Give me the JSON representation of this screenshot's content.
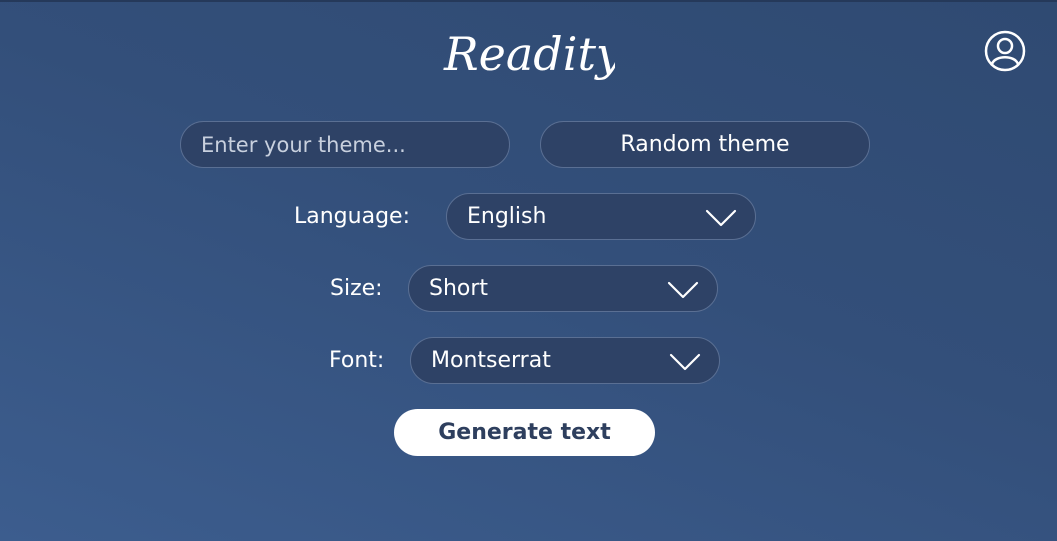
{
  "header": {
    "logo_text": "Readity",
    "user_icon": "user-circle-icon"
  },
  "controls": {
    "theme_placeholder": "Enter your theme...",
    "random_theme_label": "Random theme",
    "language": {
      "label": "Language:",
      "value": "English"
    },
    "size": {
      "label": "Size:",
      "value": "Short"
    },
    "font": {
      "label": "Font:",
      "value": "Montserrat"
    },
    "generate_label": "Generate text"
  },
  "colors": {
    "background_top": "#2f4a72",
    "background_bottom": "#3c5d8e",
    "pill_bg": "#2e4266",
    "pill_border": "#5a6f93",
    "primary_button_bg": "#ffffff",
    "primary_button_text": "#2e3f5e"
  }
}
